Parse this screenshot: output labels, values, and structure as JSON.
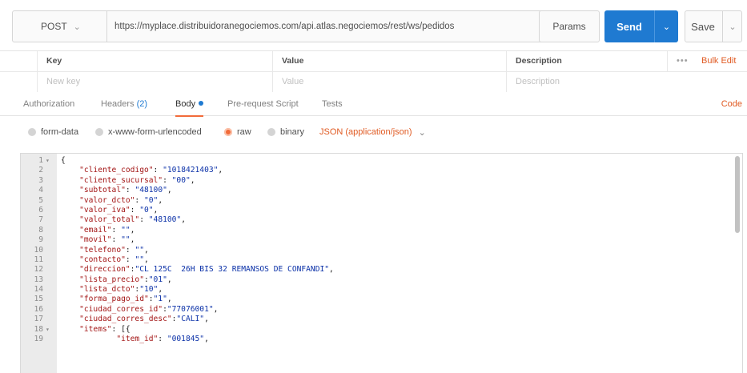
{
  "request": {
    "method": "POST",
    "url": "https://myplace.distribuidoranegociemos.com/api.atlas.negociemos/rest/ws/pedidos",
    "params_label": "Params",
    "send_label": "Send",
    "save_label": "Save"
  },
  "params_table": {
    "headers": {
      "key": "Key",
      "value": "Value",
      "description": "Description"
    },
    "bulk_dots": "•••",
    "bulk_edit": "Bulk Edit",
    "placeholders": {
      "key": "New key",
      "value": "Value",
      "description": "Description"
    }
  },
  "tabs": [
    {
      "label": "Authorization"
    },
    {
      "label": "Headers",
      "count": "(2)"
    },
    {
      "label": "Body",
      "active": true
    },
    {
      "label": "Pre-request Script"
    },
    {
      "label": "Tests"
    }
  ],
  "code_link": "Code",
  "body_modes": [
    {
      "label": "form-data",
      "selected": false
    },
    {
      "label": "x-www-form-urlencoded",
      "selected": false
    },
    {
      "label": "raw",
      "selected": true
    },
    {
      "label": "binary",
      "selected": false
    }
  ],
  "content_type": "JSON (application/json)",
  "icons": {
    "method_chevron": "chevron-down-icon",
    "send_chevron": "chevron-down-icon",
    "save_chevron": "chevron-down-icon",
    "content_type_chevron": "chevron-down-icon",
    "fold": "fold-arrow-icon"
  },
  "colors": {
    "accent_orange": "#f26b3a",
    "send_blue": "#1f7ad1",
    "json_key": "#a31515",
    "json_string": "#0b31a8"
  },
  "editor": {
    "lines": [
      {
        "n": "1",
        "fold": true,
        "text": "{"
      },
      {
        "n": "2",
        "text": "    \"cliente_codigo\": \"1018421403\","
      },
      {
        "n": "3",
        "text": "    \"cliente_sucursal\": \"00\","
      },
      {
        "n": "4",
        "text": "    \"subtotal\": \"48100\","
      },
      {
        "n": "5",
        "text": "    \"valor_dcto\": \"0\","
      },
      {
        "n": "6",
        "text": "    \"valor_iva\": \"0\","
      },
      {
        "n": "7",
        "text": "    \"valor_total\": \"48100\","
      },
      {
        "n": "8",
        "text": "    \"email\": \"\","
      },
      {
        "n": "9",
        "text": "    \"movil\": \"\","
      },
      {
        "n": "10",
        "text": "    \"telefono\": \"\","
      },
      {
        "n": "11",
        "text": "    \"contacto\": \"\","
      },
      {
        "n": "12",
        "text": "    \"direccion\":\"CL 125C  26H BIS 32 REMANSOS DE CONFANDI\","
      },
      {
        "n": "13",
        "text": "    \"lista_precio\":\"01\","
      },
      {
        "n": "14",
        "text": "    \"lista_dcto\":\"10\","
      },
      {
        "n": "15",
        "text": "    \"forma_pago_id\":\"1\","
      },
      {
        "n": "16",
        "text": "    \"ciudad_corres_id\":\"77076001\","
      },
      {
        "n": "17",
        "text": "    \"ciudad_corres_desc\":\"CALI\","
      },
      {
        "n": "18",
        "fold": true,
        "text": "    \"items\": [{"
      },
      {
        "n": "19",
        "text": "            \"item_id\": \"001845\","
      }
    ]
  }
}
